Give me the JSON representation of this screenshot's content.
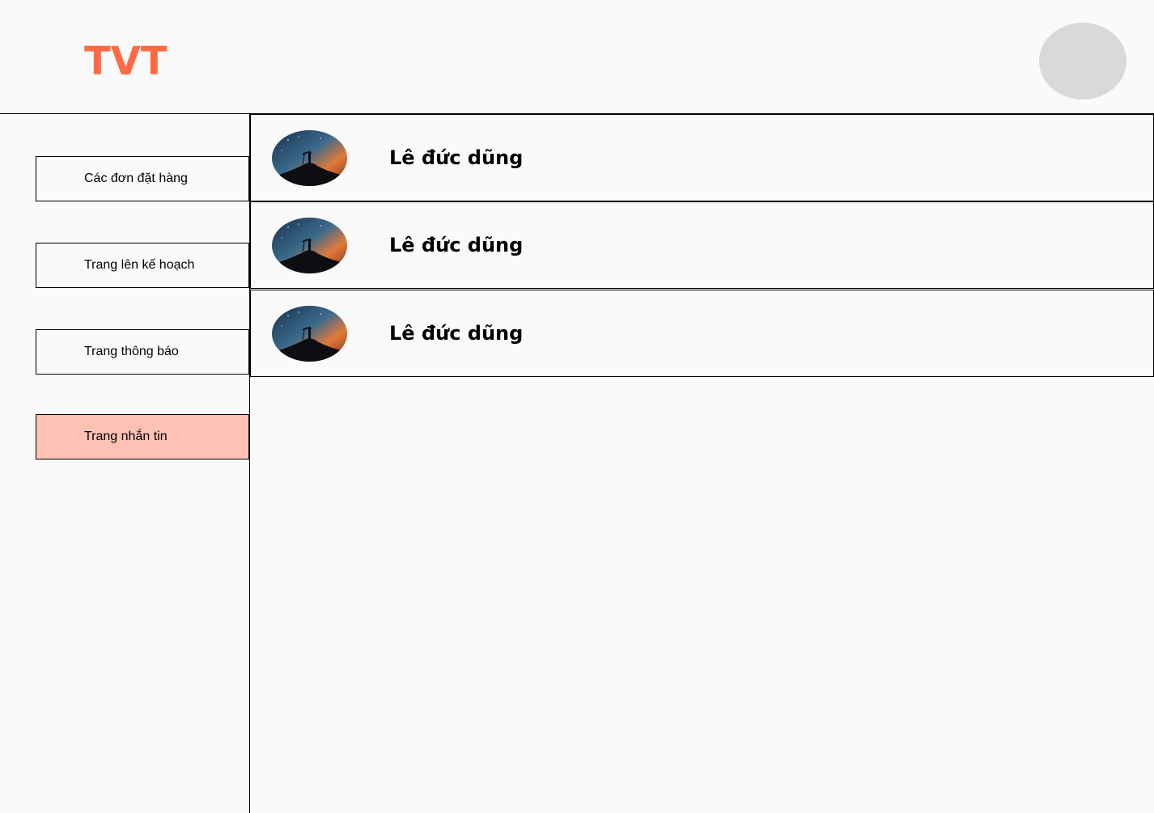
{
  "header": {
    "brand": "TVT",
    "brand_color": "#ff6a45",
    "avatar_icon": "user-avatar-placeholder"
  },
  "sidebar": {
    "items": [
      {
        "label": "Các đơn đặt hàng",
        "active": false
      },
      {
        "label": "Trang lên kế hoạch",
        "active": false
      },
      {
        "label": "Trang thông báo",
        "active": false
      },
      {
        "label": "Trang nhắn tin",
        "active": true
      }
    ],
    "active_color": "#fec1b4"
  },
  "conversations": [
    {
      "name": "Lê đức dũng",
      "avatar_icon": "photo-avatar-stargazer"
    },
    {
      "name": "Lê đức dũng",
      "avatar_icon": "photo-avatar-stargazer"
    },
    {
      "name": "Lê đức dũng",
      "avatar_icon": "photo-avatar-stargazer"
    }
  ]
}
